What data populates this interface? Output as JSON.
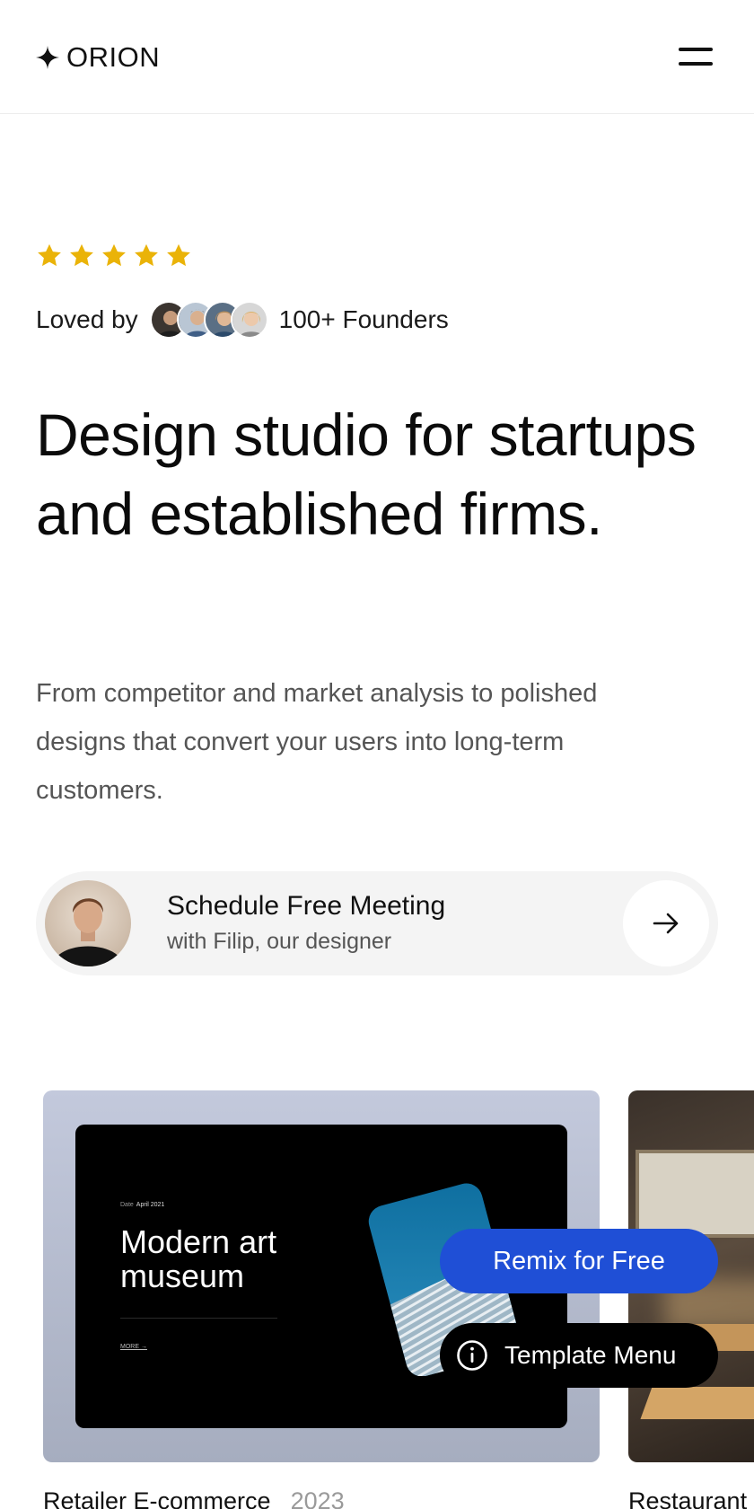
{
  "header": {
    "logo_text": "ORION",
    "menu_icon": "hamburger-menu-icon"
  },
  "rating": {
    "stars": 5,
    "max_stars": 5,
    "star_color": "#EAB308"
  },
  "social_proof": {
    "prefix": "Loved by",
    "suffix": "100+ Founders"
  },
  "hero": {
    "headline": "Design studio for startups and established firms.",
    "subtext": "From competitor and market analysis to polished designs that convert your users into long-term customers."
  },
  "cta": {
    "title": "Schedule Free Meeting",
    "subtitle": "with Filip, our designer",
    "icon": "arrow-right-icon"
  },
  "projects": [
    {
      "caption": "Retailer E-commerce",
      "year": "2023",
      "preview": {
        "date_label": "Date",
        "date_value": "April 2021",
        "title": "Modern art museum",
        "more_label": "MORE →"
      }
    },
    {
      "caption": "Restaurant"
    }
  ],
  "floating": {
    "remix_label": "Remix for Free",
    "template_menu_label": "Template Menu",
    "accent": "#1F4FD6"
  }
}
